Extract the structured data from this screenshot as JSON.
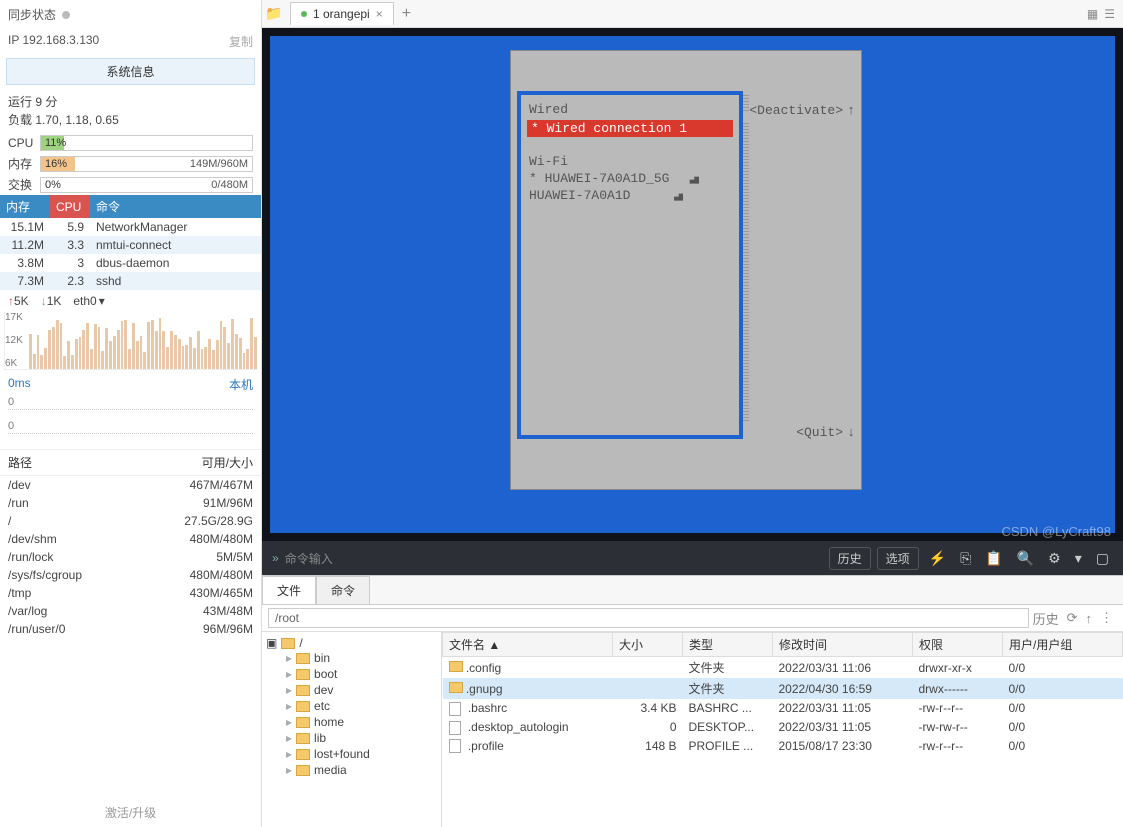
{
  "sidebar": {
    "sync_title": "同步状态",
    "ip_label": "IP",
    "ip_value": "192.168.3.130",
    "copy_label": "复制",
    "sysinfo_btn": "系统信息",
    "uptime": "运行 9 分",
    "load": "负载 1.70, 1.18, 0.65",
    "cpu_label": "CPU",
    "cpu_pct": "11%",
    "cpu_fill": "11%",
    "mem_label": "内存",
    "mem_pct": "16%",
    "mem_fill": "16%",
    "mem_right": "149M/960M",
    "swap_label": "交换",
    "swap_pct": "0%",
    "swap_right": "0/480M",
    "proc_headers": {
      "mem": "内存",
      "cpu": "CPU",
      "cmd": "命令"
    },
    "processes": [
      {
        "mem": "15.1M",
        "cpu": "5.9",
        "cmd": "NetworkManager"
      },
      {
        "mem": "11.2M",
        "cpu": "3.3",
        "cmd": "nmtui-connect"
      },
      {
        "mem": "3.8M",
        "cpu": "3",
        "cmd": "dbus-daemon"
      },
      {
        "mem": "7.3M",
        "cpu": "2.3",
        "cmd": "sshd"
      }
    ],
    "net_up": "5K",
    "net_dn": "1K",
    "iface": "eth0",
    "y_ticks": [
      "17K",
      "12K",
      "6K"
    ],
    "latency": "0ms",
    "host": "本机",
    "lat_v1": "0",
    "lat_v2": "0",
    "disk_path_h": "路径",
    "disk_avail_h": "可用/大小",
    "disks": [
      {
        "path": "/dev",
        "size": "467M/467M"
      },
      {
        "path": "/run",
        "size": "91M/96M"
      },
      {
        "path": "/",
        "size": "27.5G/28.9G"
      },
      {
        "path": "/dev/shm",
        "size": "480M/480M"
      },
      {
        "path": "/run/lock",
        "size": "5M/5M"
      },
      {
        "path": "/sys/fs/cgroup",
        "size": "480M/480M"
      },
      {
        "path": "/tmp",
        "size": "430M/465M"
      },
      {
        "path": "/var/log",
        "size": "43M/48M"
      },
      {
        "path": "/run/user/0",
        "size": "96M/96M"
      }
    ],
    "footer": "激活/升级"
  },
  "tabbar": {
    "tab_label": "1 orangepi"
  },
  "nmtui": {
    "wired": "Wired",
    "wired_conn": "* Wired connection 1",
    "wifi": "Wi-Fi",
    "net1": "* HUAWEI-7A0A1D_5G",
    "net2": "  HUAWEI-7A0A1D",
    "deactivate": "<Deactivate>",
    "quit": "<Quit>"
  },
  "cmd": {
    "placeholder": "命令输入",
    "history": "历史",
    "options": "选项"
  },
  "filepanel": {
    "tab_file": "文件",
    "tab_cmd": "命令",
    "path": "/root",
    "history": "历史",
    "headers": {
      "name": "文件名 ▲",
      "size": "大小",
      "type": "类型",
      "mtime": "修改时间",
      "perm": "权限",
      "owner": "用户/用户组"
    },
    "tree_root": "/",
    "tree": [
      "bin",
      "boot",
      "dev",
      "etc",
      "home",
      "lib",
      "lost+found",
      "media"
    ],
    "files": [
      {
        "ico": "fldr",
        "name": ".config",
        "size": "",
        "type": "文件夹",
        "mtime": "2022/03/31 11:06",
        "perm": "drwxr-xr-x",
        "owner": "0/0"
      },
      {
        "ico": "fldr",
        "name": ".gnupg",
        "size": "",
        "type": "文件夹",
        "mtime": "2022/04/30 16:59",
        "perm": "drwx------",
        "owner": "0/0"
      },
      {
        "ico": "file",
        "name": ".bashrc",
        "size": "3.4 KB",
        "type": "BASHRC ...",
        "mtime": "2022/03/31 11:05",
        "perm": "-rw-r--r--",
        "owner": "0/0"
      },
      {
        "ico": "file",
        "name": ".desktop_autologin",
        "size": "0",
        "type": "DESKTOP...",
        "mtime": "2022/03/31 11:05",
        "perm": "-rw-rw-r--",
        "owner": "0/0"
      },
      {
        "ico": "file",
        "name": ".profile",
        "size": "148 B",
        "type": "PROFILE ...",
        "mtime": "2015/08/17 23:30",
        "perm": "-rw-r--r--",
        "owner": "0/0"
      }
    ]
  },
  "watermark": "CSDN @LyCraft98"
}
